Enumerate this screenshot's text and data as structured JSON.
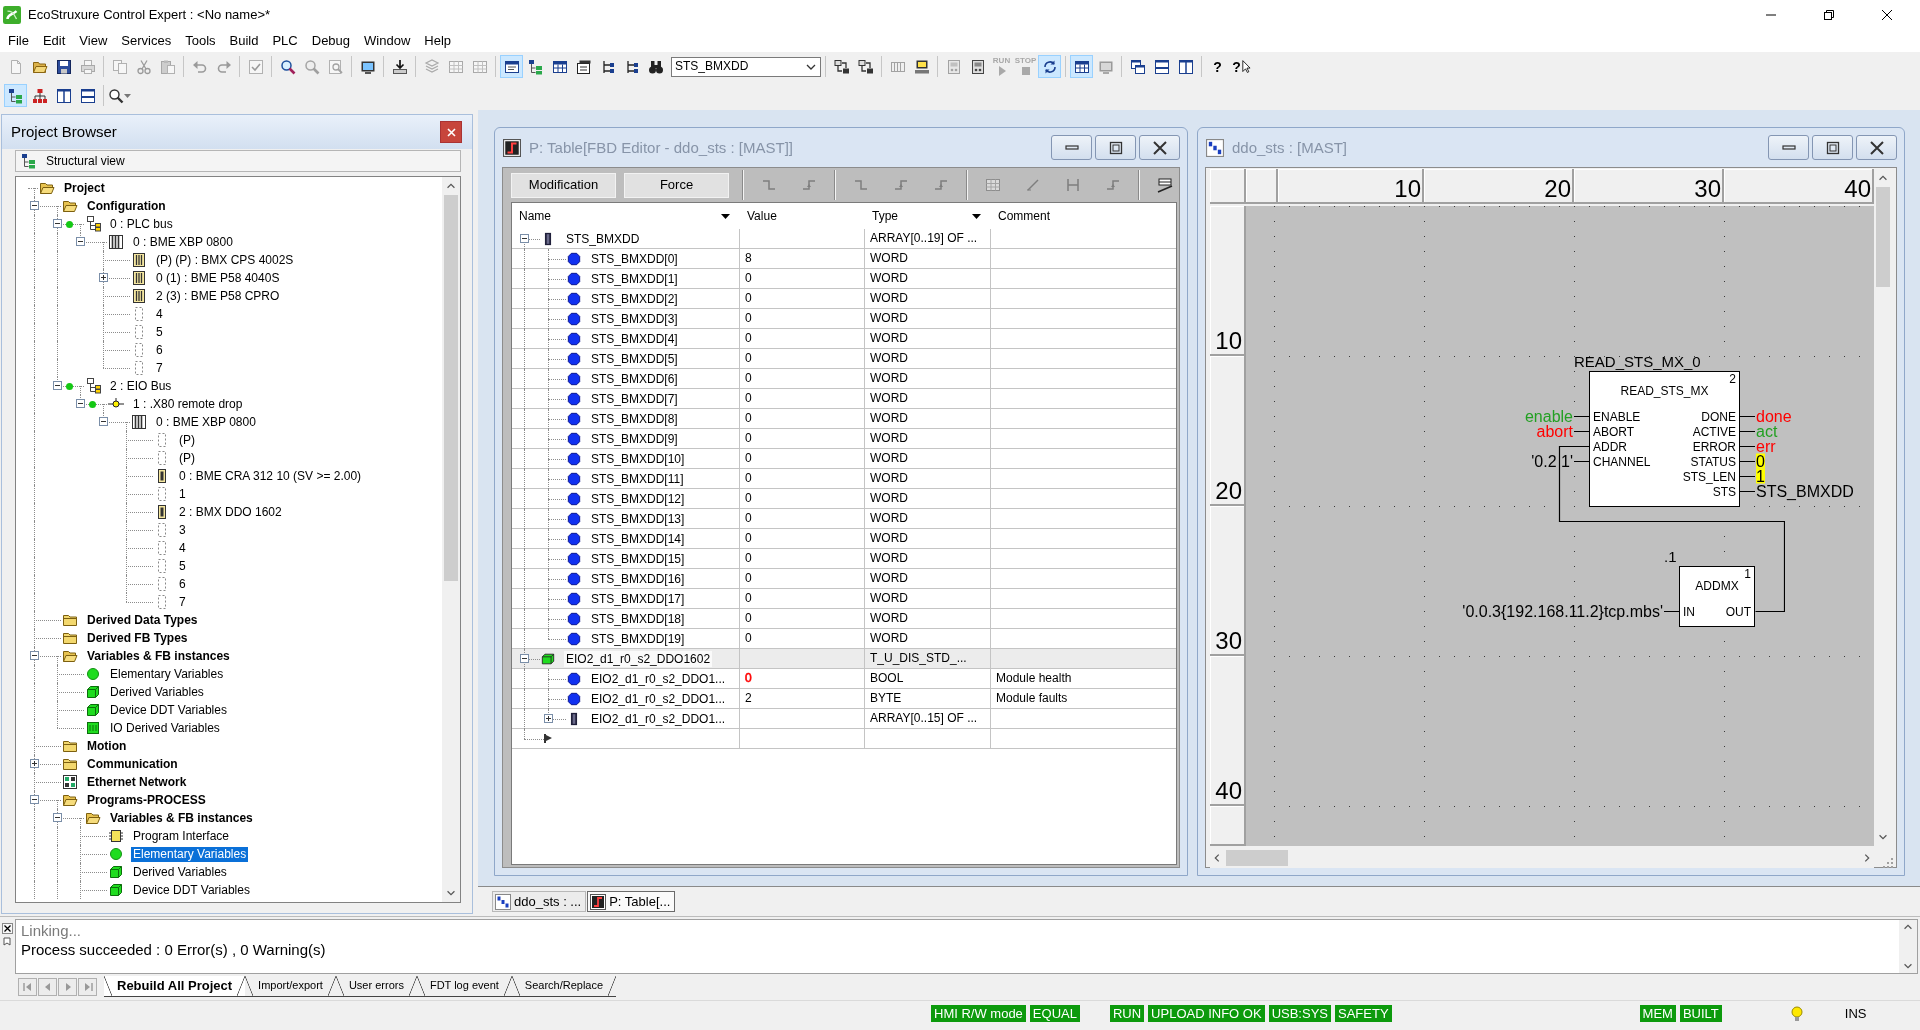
{
  "app": {
    "title": "EcoStruxure Control Expert : <No name>*"
  },
  "menu": [
    "File",
    "Edit",
    "View",
    "Services",
    "Tools",
    "Build",
    "PLC",
    "Debug",
    "Window",
    "Help"
  ],
  "toolbar": [
    [
      {
        "kind": "new",
        "disabled": true,
        "pressed": false
      },
      {
        "kind": "open",
        "disabled": false,
        "pressed": false
      },
      {
        "kind": "save",
        "disabled": false,
        "pressed": false
      },
      {
        "kind": "print",
        "disabled": true,
        "pressed": false
      }
    ],
    [
      {
        "kind": "copy",
        "disabled": true,
        "pressed": false
      },
      {
        "kind": "cut",
        "disabled": true,
        "pressed": false
      },
      {
        "kind": "paste",
        "disabled": true,
        "pressed": false
      }
    ],
    [
      {
        "kind": "undo",
        "disabled": true,
        "pressed": false
      },
      {
        "kind": "redo",
        "disabled": true,
        "pressed": false
      }
    ],
    [
      {
        "kind": "validate",
        "disabled": true,
        "pressed": false
      }
    ],
    [
      {
        "kind": "find",
        "disabled": false,
        "pressed": false
      },
      {
        "kind": "find",
        "disabled": true,
        "pressed": false
      },
      {
        "kind": "find_page",
        "disabled": true,
        "pressed": false
      }
    ],
    [
      {
        "kind": "screen",
        "disabled": false,
        "pressed": false
      }
    ],
    [
      {
        "kind": "build",
        "disabled": false,
        "pressed": false
      }
    ],
    [
      {
        "kind": "layers",
        "disabled": true,
        "pressed": false
      },
      {
        "kind": "grid",
        "disabled": true,
        "pressed": false
      },
      {
        "kind": "grid",
        "disabled": true,
        "pressed": false
      }
    ],
    [
      {
        "kind": "window",
        "disabled": false,
        "pressed": true
      },
      {
        "kind": "tree",
        "disabled": false,
        "pressed": false
      },
      {
        "kind": "table",
        "disabled": false,
        "pressed": false
      },
      {
        "kind": "cards",
        "disabled": false,
        "pressed": false
      },
      {
        "kind": "branch",
        "disabled": false,
        "pressed": false
      },
      {
        "kind": "branch",
        "disabled": false,
        "pressed": false
      },
      {
        "kind": "binoculars",
        "disabled": false,
        "pressed": false
      },
      {
        "kind": "combo",
        "value": "STS_BMXDD"
      }
    ],
    [
      {
        "kind": "transfer",
        "disabled": false,
        "pressed": false
      },
      {
        "kind": "transfer",
        "disabled": false,
        "pressed": false
      }
    ],
    [
      {
        "kind": "rack",
        "disabled": true,
        "pressed": false
      },
      {
        "kind": "computer",
        "disabled": false,
        "pressed": false
      }
    ],
    [
      {
        "kind": "device",
        "disabled": true,
        "pressed": false
      },
      {
        "kind": "device",
        "disabled": false,
        "pressed": false
      },
      {
        "kind": "run",
        "label": "RUN",
        "disabled": true,
        "pressed": false
      },
      {
        "kind": "stop",
        "label": "STOP",
        "disabled": true,
        "pressed": false
      },
      {
        "kind": "sync",
        "disabled": false,
        "pressed": true
      }
    ],
    [
      {
        "kind": "table",
        "disabled": false,
        "pressed": true
      },
      {
        "kind": "screen",
        "disabled": true,
        "pressed": false
      }
    ],
    [
      {
        "kind": "cascade",
        "disabled": false,
        "pressed": false
      },
      {
        "kind": "tile_h",
        "disabled": false,
        "pressed": false
      },
      {
        "kind": "tile_v",
        "disabled": false,
        "pressed": false
      }
    ],
    [
      {
        "kind": "help",
        "label": "?",
        "disabled": false,
        "pressed": false
      },
      {
        "kind": "context_help",
        "label": "?",
        "disabled": false,
        "pressed": false
      }
    ]
  ],
  "toolbar_2": [
    [
      {
        "kind": "tree",
        "disabled": false,
        "pressed": true
      },
      {
        "kind": "org_chart",
        "disabled": false,
        "pressed": false
      },
      {
        "kind": "tile_v",
        "disabled": false,
        "pressed": false
      },
      {
        "kind": "tile_h",
        "disabled": false,
        "pressed": false
      }
    ],
    [
      {
        "kind": "zoom",
        "disabled": false,
        "pressed": false
      }
    ]
  ],
  "project_browser": {
    "title": "Project Browser",
    "view": "Structural view",
    "tree": [
      {
        "label": "Project",
        "kind": "folder_open",
        "selected": false,
        "children": [
          {
            "label": "Configuration",
            "kind": "folder_open",
            "expanded": true,
            "selected": false,
            "children": [
              {
                "label": "0 : PLC bus",
                "kind": "bus",
                "expanded": true,
                "selected": false,
                "children": [
                  {
                    "label": "0 : BME XBP 0800",
                    "kind": "rack",
                    "expanded": true,
                    "selected": false,
                    "children": [
                      {
                        "label": "(P) (P) : BMX CPS 4002S",
                        "kind": "module",
                        "selected": false
                      },
                      {
                        "label": "0 (1) : BME P58 4040S",
                        "kind": "module",
                        "expanded": false,
                        "selected": false
                      },
                      {
                        "label": "2 (3) : BME P58 CPRO",
                        "kind": "module",
                        "selected": false
                      },
                      {
                        "label": "4",
                        "kind": "slot",
                        "selected": false
                      },
                      {
                        "label": "5",
                        "kind": "slot",
                        "selected": false
                      },
                      {
                        "label": "6",
                        "kind": "slot",
                        "selected": false
                      },
                      {
                        "label": "7",
                        "kind": "slot",
                        "selected": false
                      }
                    ]
                  }
                ]
              },
              {
                "label": "2 : EIO Bus",
                "kind": "bus",
                "expanded": true,
                "selected": false,
                "children": [
                  {
                    "label": "1 : .X80 remote drop",
                    "kind": "drop",
                    "expanded": true,
                    "selected": false,
                    "children": [
                      {
                        "label": "0 : BME XBP 0800",
                        "kind": "rack",
                        "expanded": true,
                        "selected": false,
                        "children": [
                          {
                            "label": "(P)",
                            "kind": "slot",
                            "selected": false
                          },
                          {
                            "label": "(P)",
                            "kind": "slot",
                            "selected": false
                          },
                          {
                            "label": "0 : BME CRA 312 10 (SV >= 2.00)",
                            "kind": "card",
                            "selected": false
                          },
                          {
                            "label": "1",
                            "kind": "slot",
                            "selected": false
                          },
                          {
                            "label": "2 : BMX DDO 1602",
                            "kind": "card",
                            "selected": false
                          },
                          {
                            "label": "3",
                            "kind": "slot",
                            "selected": false
                          },
                          {
                            "label": "4",
                            "kind": "slot",
                            "selected": false
                          },
                          {
                            "label": "5",
                            "kind": "slot",
                            "selected": false
                          },
                          {
                            "label": "6",
                            "kind": "slot",
                            "selected": false
                          },
                          {
                            "label": "7",
                            "kind": "slot",
                            "selected": false
                          }
                        ]
                      }
                    ]
                  }
                ]
              }
            ]
          },
          {
            "label": "Derived Data Types",
            "kind": "folder",
            "selected": false
          },
          {
            "label": "Derived FB Types",
            "kind": "folder",
            "selected": false
          },
          {
            "label": "Variables & FB instances",
            "kind": "folder_open",
            "expanded": true,
            "selected": false,
            "children": [
              {
                "label": "Elementary Variables",
                "kind": "elementary",
                "selected": false
              },
              {
                "label": "Derived Variables",
                "kind": "derived",
                "selected": false
              },
              {
                "label": "Device DDT Variables",
                "kind": "derived",
                "selected": false
              },
              {
                "label": "IO Derived Variables",
                "kind": "io_derived",
                "selected": false
              }
            ]
          },
          {
            "label": "Motion",
            "kind": "folder",
            "selected": false
          },
          {
            "label": "Communication",
            "kind": "folder",
            "expanded": false,
            "selected": false
          },
          {
            "label": "Ethernet Network",
            "kind": "network",
            "selected": false
          },
          {
            "label": "Programs-PROCESS",
            "kind": "folder_open",
            "expanded": true,
            "selected": false,
            "children": [
              {
                "label": "Variables & FB instances",
                "kind": "folder_open",
                "expanded": true,
                "selected": false,
                "children": [
                  {
                    "label": "Program Interface",
                    "kind": "interface",
                    "selected": false
                  },
                  {
                    "label": "Elementary Variables",
                    "kind": "elementary",
                    "selected": true
                  },
                  {
                    "label": "Derived Variables",
                    "kind": "derived",
                    "selected": false
                  },
                  {
                    "label": "Device DDT Variables",
                    "kind": "derived",
                    "selected": false
                  }
                ]
              }
            ]
          }
        ]
      }
    ]
  },
  "table_window": {
    "title": "P: Table[FBD Editor - ddo_sts : [MAST]]",
    "buttons": [
      "Modification",
      "Force"
    ],
    "tools": [
      [
        {
          "kind": "step_down",
          "disabled": true,
          "pressed": false
        },
        {
          "kind": "step_up",
          "disabled": true,
          "pressed": false
        }
      ],
      [
        {
          "kind": "step_down",
          "disabled": true,
          "pressed": false
        },
        {
          "kind": "step_up",
          "disabled": true,
          "pressed": false
        },
        {
          "kind": "step_up",
          "disabled": true,
          "pressed": false
        }
      ],
      [
        {
          "kind": "grid",
          "disabled": true,
          "pressed": false
        },
        {
          "kind": "slash",
          "disabled": true,
          "pressed": false
        },
        {
          "kind": "bracket",
          "disabled": true,
          "pressed": false
        },
        {
          "kind": "step_up",
          "disabled": true,
          "pressed": false
        }
      ],
      [
        {
          "kind": "table_line",
          "disabled": false,
          "pressed": false
        }
      ]
    ],
    "columns": [
      {
        "label": "Name",
        "filter": true
      },
      {
        "label": "Value",
        "filter": false
      },
      {
        "label": "Type",
        "filter": true
      },
      {
        "label": "Comment",
        "filter": false
      }
    ],
    "rows": [
      {
        "name": "STS_BMXDD",
        "kind": "array",
        "type": "ARRAY[0..19] OF ...",
        "expanded": true,
        "selected": false,
        "children": [
          {
            "name": "STS_BMXDD[0]",
            "kind": "elementary",
            "value": "8",
            "type": "WORD",
            "selected": false
          },
          {
            "name": "STS_BMXDD[1]",
            "kind": "elementary",
            "value": "0",
            "type": "WORD",
            "selected": false
          },
          {
            "name": "STS_BMXDD[2]",
            "kind": "elementary",
            "value": "0",
            "type": "WORD",
            "selected": false
          },
          {
            "name": "STS_BMXDD[3]",
            "kind": "elementary",
            "value": "0",
            "type": "WORD",
            "selected": false
          },
          {
            "name": "STS_BMXDD[4]",
            "kind": "elementary",
            "value": "0",
            "type": "WORD",
            "selected": false
          },
          {
            "name": "STS_BMXDD[5]",
            "kind": "elementary",
            "value": "0",
            "type": "WORD",
            "selected": false
          },
          {
            "name": "STS_BMXDD[6]",
            "kind": "elementary",
            "value": "0",
            "type": "WORD",
            "selected": false
          },
          {
            "name": "STS_BMXDD[7]",
            "kind": "elementary",
            "value": "0",
            "type": "WORD",
            "selected": false
          },
          {
            "name": "STS_BMXDD[8]",
            "kind": "elementary",
            "value": "0",
            "type": "WORD",
            "selected": false
          },
          {
            "name": "STS_BMXDD[9]",
            "kind": "elementary",
            "value": "0",
            "type": "WORD",
            "selected": false
          },
          {
            "name": "STS_BMXDD[10]",
            "kind": "elementary",
            "value": "0",
            "type": "WORD",
            "selected": false
          },
          {
            "name": "STS_BMXDD[11]",
            "kind": "elementary",
            "value": "0",
            "type": "WORD",
            "selected": false
          },
          {
            "name": "STS_BMXDD[12]",
            "kind": "elementary",
            "value": "0",
            "type": "WORD",
            "selected": false
          },
          {
            "name": "STS_BMXDD[13]",
            "kind": "elementary",
            "value": "0",
            "type": "WORD",
            "selected": false
          },
          {
            "name": "STS_BMXDD[14]",
            "kind": "elementary",
            "value": "0",
            "type": "WORD",
            "selected": false
          },
          {
            "name": "STS_BMXDD[15]",
            "kind": "elementary",
            "value": "0",
            "type": "WORD",
            "selected": false
          },
          {
            "name": "STS_BMXDD[16]",
            "kind": "elementary",
            "value": "0",
            "type": "WORD",
            "selected": false
          },
          {
            "name": "STS_BMXDD[17]",
            "kind": "elementary",
            "value": "0",
            "type": "WORD",
            "selected": false
          },
          {
            "name": "STS_BMXDD[18]",
            "kind": "elementary",
            "value": "0",
            "type": "WORD",
            "selected": false
          },
          {
            "name": "STS_BMXDD[19]",
            "kind": "elementary",
            "value": "0",
            "type": "WORD",
            "selected": false
          }
        ]
      },
      {
        "name": "EIO2_d1_r0_s2_DDO1602",
        "kind": "ddt",
        "type": "T_U_DIS_STD_...",
        "expanded": true,
        "selected": true,
        "children": [
          {
            "name": "EIO2_d1_r0_s2_DDO1...",
            "kind": "elementary",
            "value": "0",
            "color": "#ff0000",
            "type": "BOOL",
            "comment": "Module health",
            "selected": false
          },
          {
            "name": "EIO2_d1_r0_s2_DDO1...",
            "kind": "elementary",
            "value": "2",
            "type": "BYTE",
            "comment": "Module faults",
            "selected": false
          },
          {
            "name": "EIO2_d1_r0_s2_DDO1...",
            "kind": "array",
            "type": "ARRAY[0..15] OF ...",
            "expanded": false,
            "selected": false
          }
        ]
      }
    ]
  },
  "fbd_window": {
    "title": "ddo_sts : [MAST]",
    "column_ruler": [
      "10",
      "20",
      "30",
      "40"
    ],
    "row_ruler": [
      "10",
      "20",
      "30",
      "40"
    ],
    "blocks": [
      {
        "type": "READ_STS_MX",
        "instance": "READ_STS_MX_0",
        "exec_order": "2",
        "inputs": [
          {
            "pin": "ENABLE",
            "link": "enable",
            "color": "#22a022",
            "wired": false
          },
          {
            "pin": "ABORT",
            "link": "abort",
            "color": "#ff0000",
            "wired": false
          },
          {
            "pin": "ADDR",
            "wired": true
          },
          {
            "pin": "CHANNEL",
            "link": "'0.2 1'",
            "wired": false
          }
        ],
        "outputs": [
          {
            "pin": "DONE",
            "link": "done",
            "color": "#ff0000",
            "wired": false
          },
          {
            "pin": "ACTIVE",
            "link": "act",
            "color": "#22a022",
            "wired": false
          },
          {
            "pin": "ERROR",
            "link": "err",
            "color": "#ff0000",
            "wired": false
          },
          {
            "pin": "STATUS",
            "link": "0",
            "live": true,
            "wired": false
          },
          {
            "pin": "STS_LEN",
            "link": "1",
            "live": true,
            "wired": false
          },
          {
            "pin": "STS",
            "link": "STS_BMXDD",
            "wired": false
          }
        ]
      },
      {
        "type": "ADDMX",
        "instance": ".1",
        "exec_order": "1",
        "inputs": [
          {
            "pin": "IN",
            "link": "'0.0.3{192.168.11.2}tcp.mbs'",
            "wired": false
          }
        ],
        "outputs": [
          {
            "pin": "OUT",
            "wired": true
          }
        ]
      }
    ]
  },
  "window_tabs": [
    {
      "label": "ddo_sts : ...",
      "kind": "fbd",
      "selected": false
    },
    {
      "label": "P: Table[...",
      "kind": "table",
      "selected": true
    }
  ],
  "output": {
    "lines": [
      {
        "text": "Linking...",
        "kind": "progress"
      },
      {
        "text": "Process succeeded : 0 Error(s) , 0 Warning(s)",
        "kind": "result"
      }
    ],
    "tabs": [
      {
        "label": "Rebuild All Project",
        "selected": true
      },
      {
        "label": "Import/export",
        "selected": false
      },
      {
        "label": "User errors",
        "selected": false
      },
      {
        "label": "FDT log event",
        "selected": false
      },
      {
        "label": "Search/Replace",
        "selected": false
      }
    ]
  },
  "status_bar": [
    {
      "kind": "indicator",
      "text": "HMI R/W mode"
    },
    {
      "kind": "indicator",
      "text": "EQUAL"
    },
    {
      "kind": "indicator",
      "text": "RUN"
    },
    {
      "kind": "indicator",
      "text": "UPLOAD INFO OK"
    },
    {
      "kind": "indicator",
      "text": "USB:SYS"
    },
    {
      "kind": "indicator",
      "text": "SAFETY"
    },
    {
      "kind": "indicator",
      "text": "MEM"
    },
    {
      "kind": "indicator",
      "text": "BUILT"
    },
    {
      "kind": "bulb"
    },
    {
      "kind": "plain",
      "text": "INS"
    }
  ]
}
